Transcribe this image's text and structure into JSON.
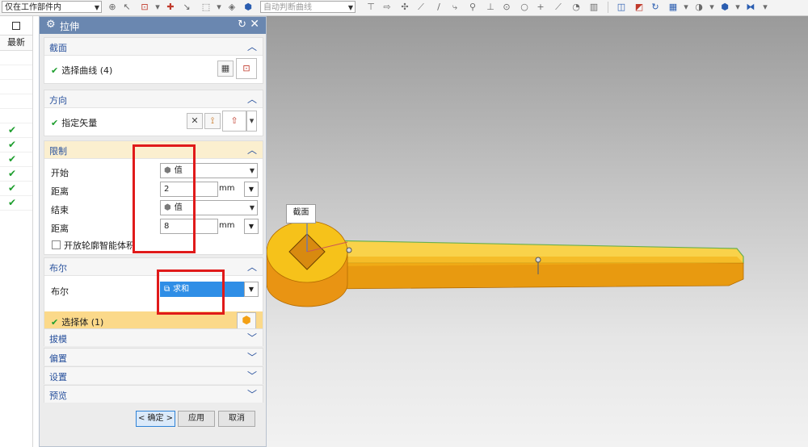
{
  "toolbar": {
    "filter_select": "仅在工作部件内",
    "curve_rule_select": "自动判断曲线"
  },
  "left_strip": {
    "column_header": "最新",
    "check_rows": [
      false,
      false,
      false,
      false,
      false,
      true,
      true,
      true,
      true,
      true,
      true
    ]
  },
  "dialog": {
    "title": "拉伸",
    "sections": {
      "section": {
        "header": "截面",
        "select_curve": "选择曲线 (4)"
      },
      "direction": {
        "header": "方向",
        "specify_vector": "指定矢量"
      },
      "limits": {
        "header": "限制",
        "start_label": "开始",
        "start_value": "值",
        "distance1_label": "距离",
        "distance1_value": "2",
        "distance1_unit": "mm",
        "end_label": "结束",
        "end_value": "值",
        "distance2_label": "距离",
        "distance2_value": "8",
        "distance2_unit": "mm",
        "open_profile_checkbox": "开放轮廓智能体积"
      },
      "boolean": {
        "header": "布尔",
        "boolean_label": "布尔",
        "boolean_value": "求和",
        "select_body": "选择体 (1)"
      },
      "draft": {
        "header": "拔模"
      },
      "offset": {
        "header": "偏置"
      },
      "settings": {
        "header": "设置"
      },
      "preview": {
        "header": "预览"
      }
    },
    "buttons": {
      "ok": "< 确定 >",
      "apply": "应用",
      "cancel": "取消"
    }
  },
  "viewport": {
    "section_tag": "截面"
  },
  "colors": {
    "title_bar": "#6a87b0",
    "section_header_text": "#27509c",
    "highlight_header": "#fbefcf",
    "selected_row": "#fbd98a",
    "selected_combo": "#2f8ee6",
    "red_annotation": "#e01a1a",
    "model_yellow": "#f6c21a",
    "model_orange": "#f3a014"
  }
}
